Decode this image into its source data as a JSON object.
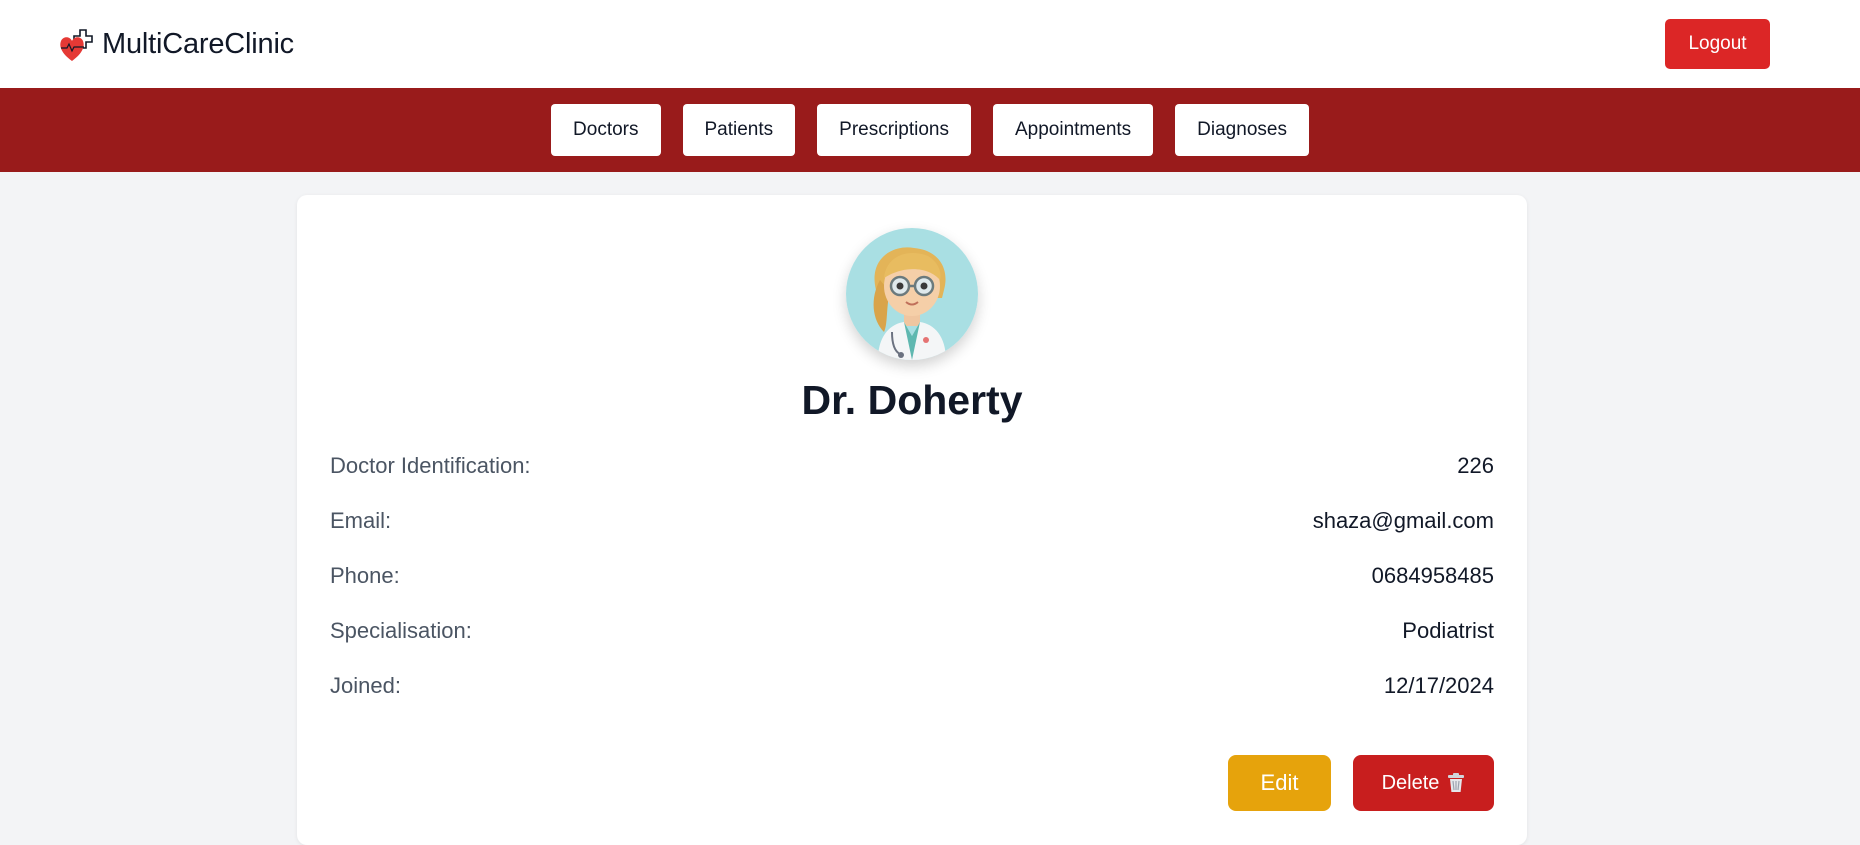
{
  "header": {
    "brand_name": "MultiCareClinic",
    "logo_icon": "heart-cross-icon",
    "logout_label": "Logout"
  },
  "nav": {
    "items": [
      {
        "label": "Doctors"
      },
      {
        "label": "Patients"
      },
      {
        "label": "Prescriptions"
      },
      {
        "label": "Appointments"
      },
      {
        "label": "Diagnoses"
      }
    ]
  },
  "profile": {
    "avatar_icon": "doctor-avatar",
    "name": "Dr. Doherty",
    "fields": [
      {
        "label": "Doctor Identification:",
        "value": "226"
      },
      {
        "label": "Email:",
        "value": "shaza@gmail.com"
      },
      {
        "label": "Phone:",
        "value": "0684958485"
      },
      {
        "label": "Specialisation:",
        "value": "Podiatrist"
      },
      {
        "label": "Joined:",
        "value": "12/17/2024"
      }
    ]
  },
  "actions": {
    "edit_label": "Edit",
    "delete_label": "Delete",
    "delete_icon": "trash-icon"
  },
  "colors": {
    "nav_background": "#991b1b",
    "logout": "#dc2626",
    "edit": "#e6a30c",
    "delete": "#c81e1e",
    "page_background": "#f3f4f6",
    "avatar_background": "#a9dfe3"
  }
}
